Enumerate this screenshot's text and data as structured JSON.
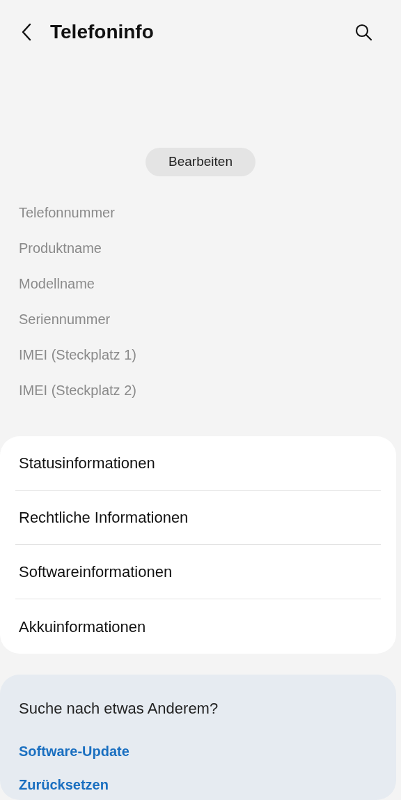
{
  "header": {
    "title": "Telefoninfo"
  },
  "edit_button": "Bearbeiten",
  "info_labels": [
    "Telefonnummer",
    "Produktname",
    "Modellname",
    "Seriennummer",
    "IMEI (Steckplatz 1)",
    "IMEI (Steckplatz 2)"
  ],
  "menu_items": [
    "Statusinformationen",
    "Rechtliche Informationen",
    "Softwareinformationen",
    "Akkuinformationen"
  ],
  "suggestions": {
    "title": "Suche nach etwas Anderem?",
    "links": [
      "Software-Update",
      "Zurücksetzen"
    ]
  }
}
